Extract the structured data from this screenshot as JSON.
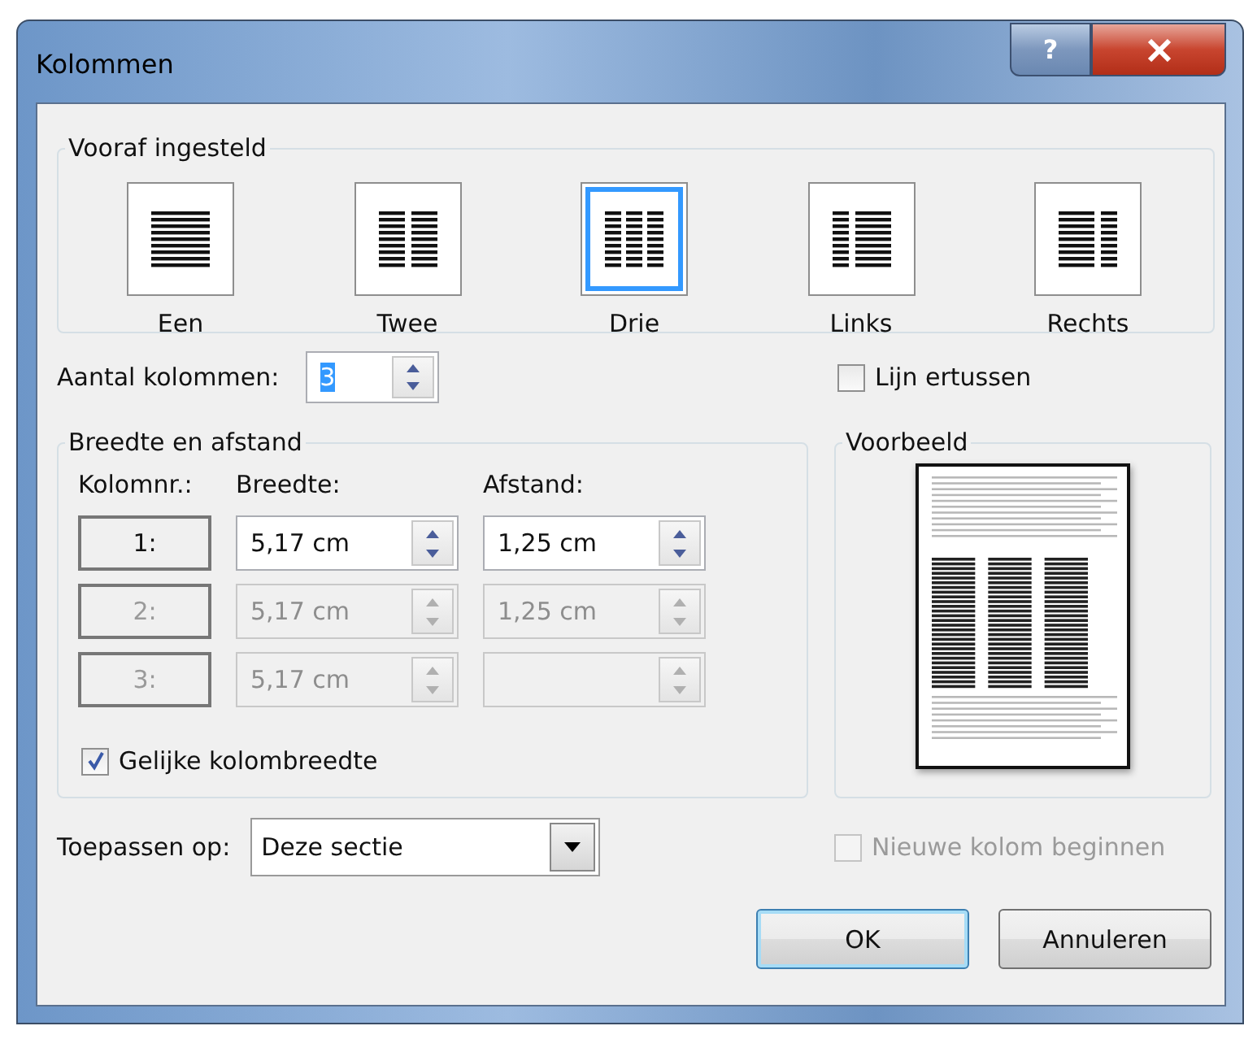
{
  "window": {
    "title": "Kolommen",
    "help_button": "?"
  },
  "presets": {
    "title": "Vooraf ingesteld",
    "items": [
      {
        "label": "Een",
        "kind": "one",
        "selected": false
      },
      {
        "label": "Twee",
        "kind": "two",
        "selected": false
      },
      {
        "label": "Drie",
        "kind": "three",
        "selected": true
      },
      {
        "label": "Links",
        "kind": "left",
        "selected": false
      },
      {
        "label": "Rechts",
        "kind": "right",
        "selected": false
      }
    ]
  },
  "number_of_columns": {
    "label": "Aantal kolommen:",
    "value": "3"
  },
  "line_between": {
    "label": "Lijn ertussen",
    "checked": false
  },
  "width_spacing": {
    "title": "Breedte en afstand",
    "headers": [
      "Kolomnr.:",
      "Breedte:",
      "Afstand:"
    ],
    "rows": [
      {
        "number": "1:",
        "width": "5,17 cm",
        "spacing": "1,25 cm",
        "disabled": false
      },
      {
        "number": "2:",
        "width": "5,17 cm",
        "spacing": "1,25 cm",
        "disabled": true
      },
      {
        "number": "3:",
        "width": "5,17 cm",
        "disabled": true
      }
    ],
    "equal_width": {
      "label": "Gelijke kolombreedte",
      "checked": true
    }
  },
  "preview": {
    "title": "Voorbeeld"
  },
  "new_column": {
    "label": "Nieuwe kolom beginnen",
    "checked": false,
    "disabled": true
  },
  "apply_to": {
    "label": "Toepassen op:",
    "value": "Deze sectie"
  },
  "buttons": [
    {
      "label": "OK",
      "default": true
    },
    {
      "label": "Annuleren",
      "default": false
    }
  ]
}
